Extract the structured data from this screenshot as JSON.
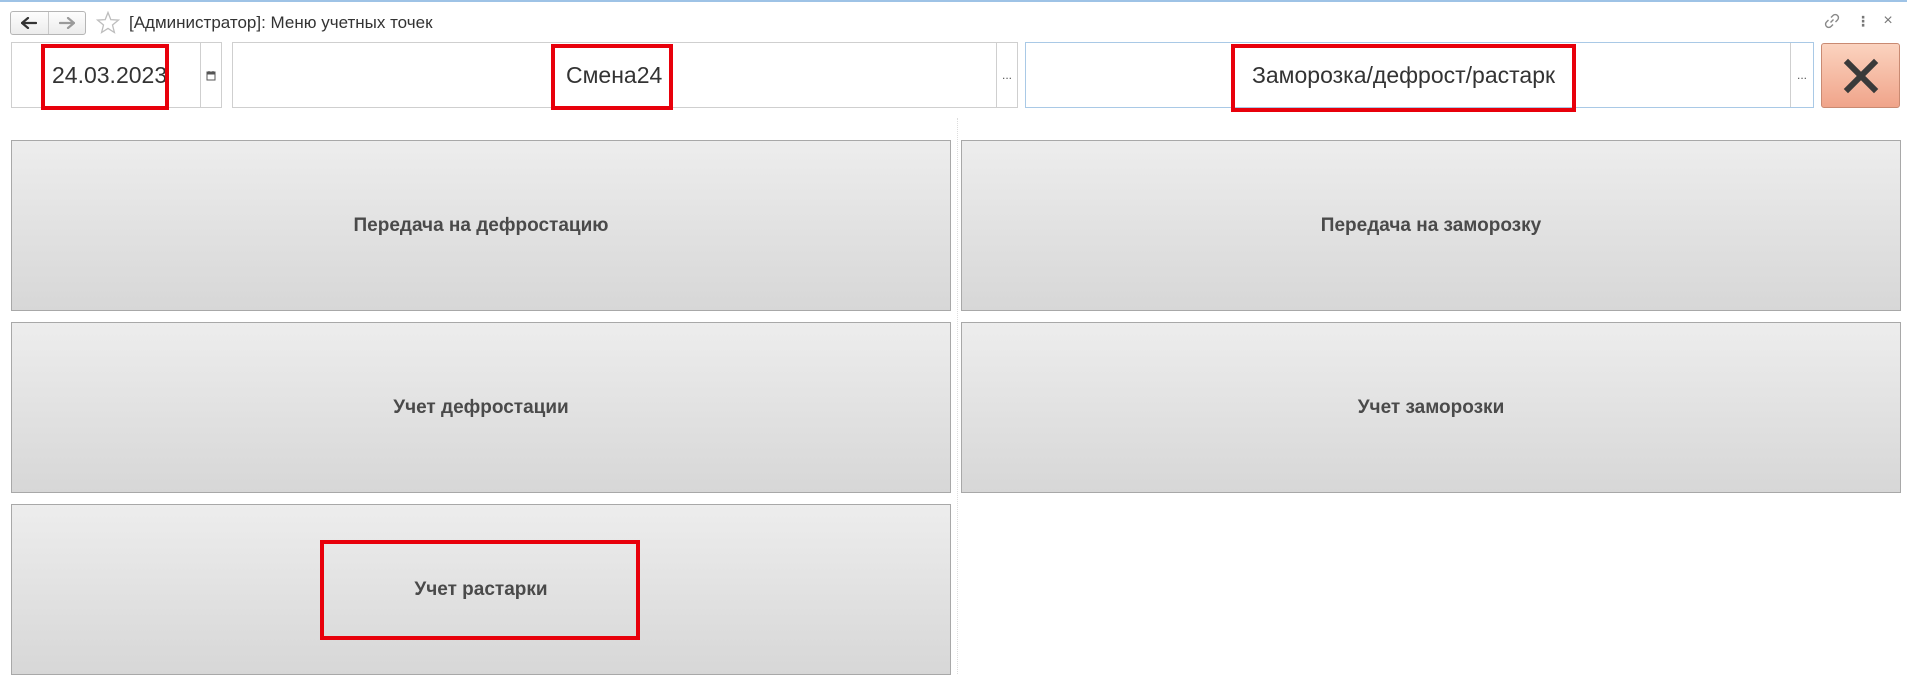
{
  "window": {
    "title": "[Администратор]: Меню учетных точек"
  },
  "toolbar": {
    "back_icon": "arrow-left-icon",
    "forward_icon": "arrow-right-icon",
    "favorite_icon": "star-icon",
    "link_icon": "link-icon",
    "more_icon": "more-vertical-icon",
    "close_icon": "close-icon",
    "more_glyph": "⋮",
    "close_glyph": "×"
  },
  "fields": {
    "date": {
      "value": "24.03.2023",
      "button_icon": "calendar-icon"
    },
    "shift": {
      "value": "Смена24",
      "button_label": "..."
    },
    "point": {
      "value": "Заморозка/дефрост/растарк",
      "button_label": "..."
    }
  },
  "close_button": {
    "icon": "close-x-icon"
  },
  "menu": {
    "btn_transfer_defrost": "Передача на дефростацию",
    "btn_transfer_freeze": "Передача на заморозку",
    "btn_defrost_accounting": "Учет дефростации",
    "btn_freeze_accounting": "Учет заморозки",
    "btn_unpacking_accounting": "Учет растарки"
  },
  "colors": {
    "highlight": "#e8000b",
    "close_button_bg": "#f0a48a",
    "menu_button_bg": "#e0e0e0"
  }
}
